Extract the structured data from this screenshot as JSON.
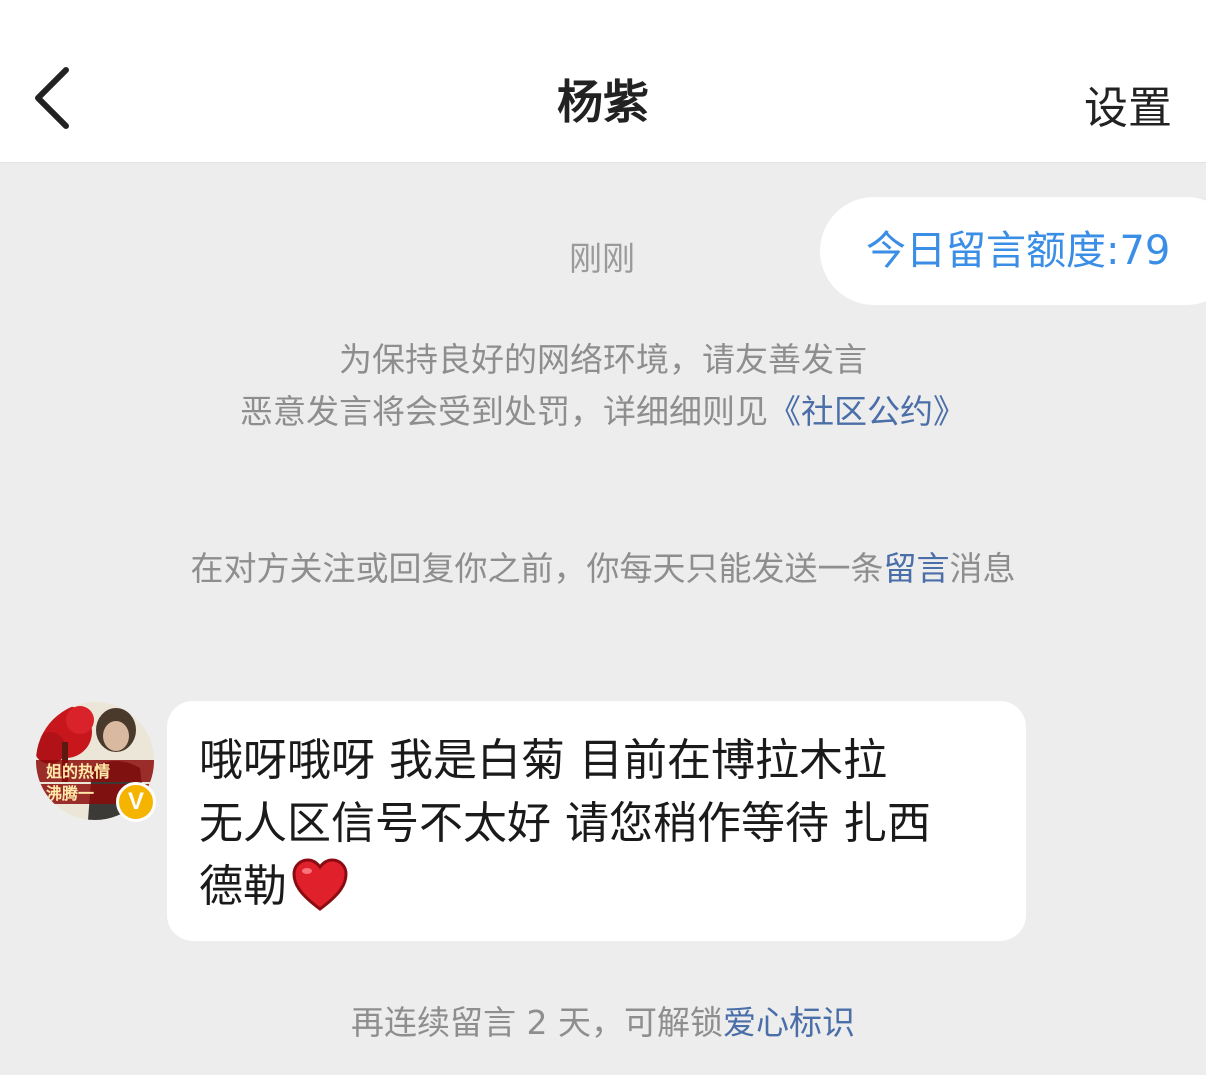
{
  "header": {
    "back_icon": "chevron-left-icon",
    "title": "杨紫",
    "settings_label": "设置"
  },
  "quota": {
    "label": "今日留言额度:79",
    "color": "#3a8ee6"
  },
  "timestamp": "刚刚",
  "notice": {
    "line1": "为保持良好的网络环境，请友善发言",
    "line2_prefix": "恶意发言将会受到处罚，详细细则见",
    "line2_link": "《社区公约》"
  },
  "limit_note": {
    "prefix": "在对方关注或回复你之前，你每天只能发送一条",
    "link": "留言",
    "suffix": "消息"
  },
  "message": {
    "avatar_caption_line1": "姐的热情",
    "avatar_caption_line2": "沸腾一",
    "verified_mark": "V",
    "line1": "哦呀哦呀 我是白菊 目前在博拉木拉",
    "line2": "无人区信号不太好 请您稍作等待 扎西",
    "line3": "德勒",
    "emoji": "heart-icon"
  },
  "unlock_note": {
    "prefix": "再连续留言 2 天，可解锁",
    "link": "爱心标识"
  },
  "colors": {
    "background": "#ededed",
    "link": "#4a6ea8",
    "muted_text": "#8e8e8e",
    "heart": "#e0202a"
  }
}
